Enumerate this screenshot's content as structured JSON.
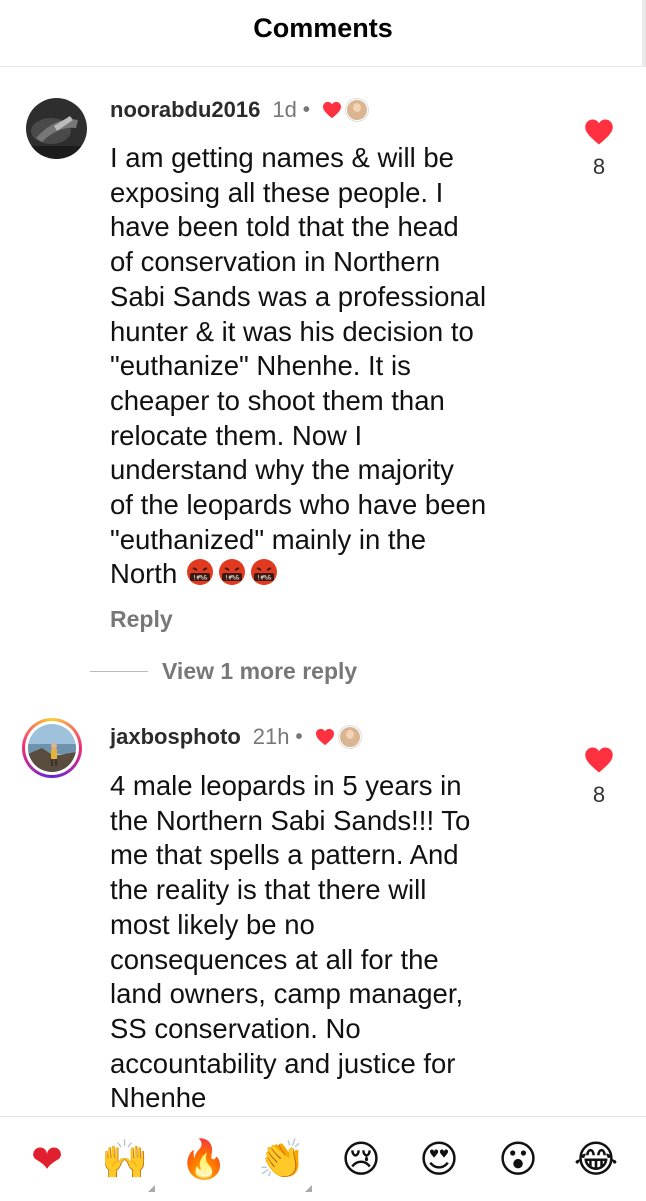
{
  "header": {
    "title": "Comments"
  },
  "comments": [
    {
      "username": "noorabdu2016",
      "time": "1d",
      "separator": "•",
      "text": "I am getting names & will be\nexposing all these people. I\nhave been told that the head\nof conservation in Northern\nSabi Sands was a professional\nhunter & it was his decision to\n\"euthanize\" Nhenhe. It is\ncheaper to shoot them than\nrelocate them. Now I\nunderstand why the majority\nof the leopards who have been\n\"euthanized\" mainly in the\nNorth",
      "trailing_emojis": [
        "face-with-symbols-on-mouth",
        "face-with-symbols-on-mouth",
        "face-with-symbols-on-mouth"
      ],
      "reply_label": "Reply",
      "view_more_label": "View 1 more reply",
      "likes": "8",
      "liked": true
    },
    {
      "username": "jaxbosphoto",
      "time": "21h",
      "separator": "•",
      "text": "4 male leopards in 5 years in\nthe Northern Sabi Sands!!! To\nme that spells a pattern. And\nthe reality is that there will\nmost likely be no\nconsequences at all for the\nland owners, camp manager,\nSS conservation. No\naccountability and justice for\nNhenhe",
      "likes": "8",
      "liked": true
    }
  ],
  "reactions": [
    {
      "name": "red-heart-emoji",
      "glyph": "❤"
    },
    {
      "name": "raising-hands-emoji",
      "glyph": "🙌"
    },
    {
      "name": "fire-emoji",
      "glyph": "🔥"
    },
    {
      "name": "clapping-hands-emoji",
      "glyph": "👏"
    },
    {
      "name": "crying-face-emoji",
      "glyph": "😢"
    },
    {
      "name": "heart-eyes-emoji",
      "glyph": "😍"
    },
    {
      "name": "surprised-face-emoji",
      "glyph": "😮"
    },
    {
      "name": "tears-of-joy-emoji",
      "glyph": "😂"
    }
  ],
  "colors": {
    "like_red": "#ff3040",
    "muted_text": "#777777"
  }
}
